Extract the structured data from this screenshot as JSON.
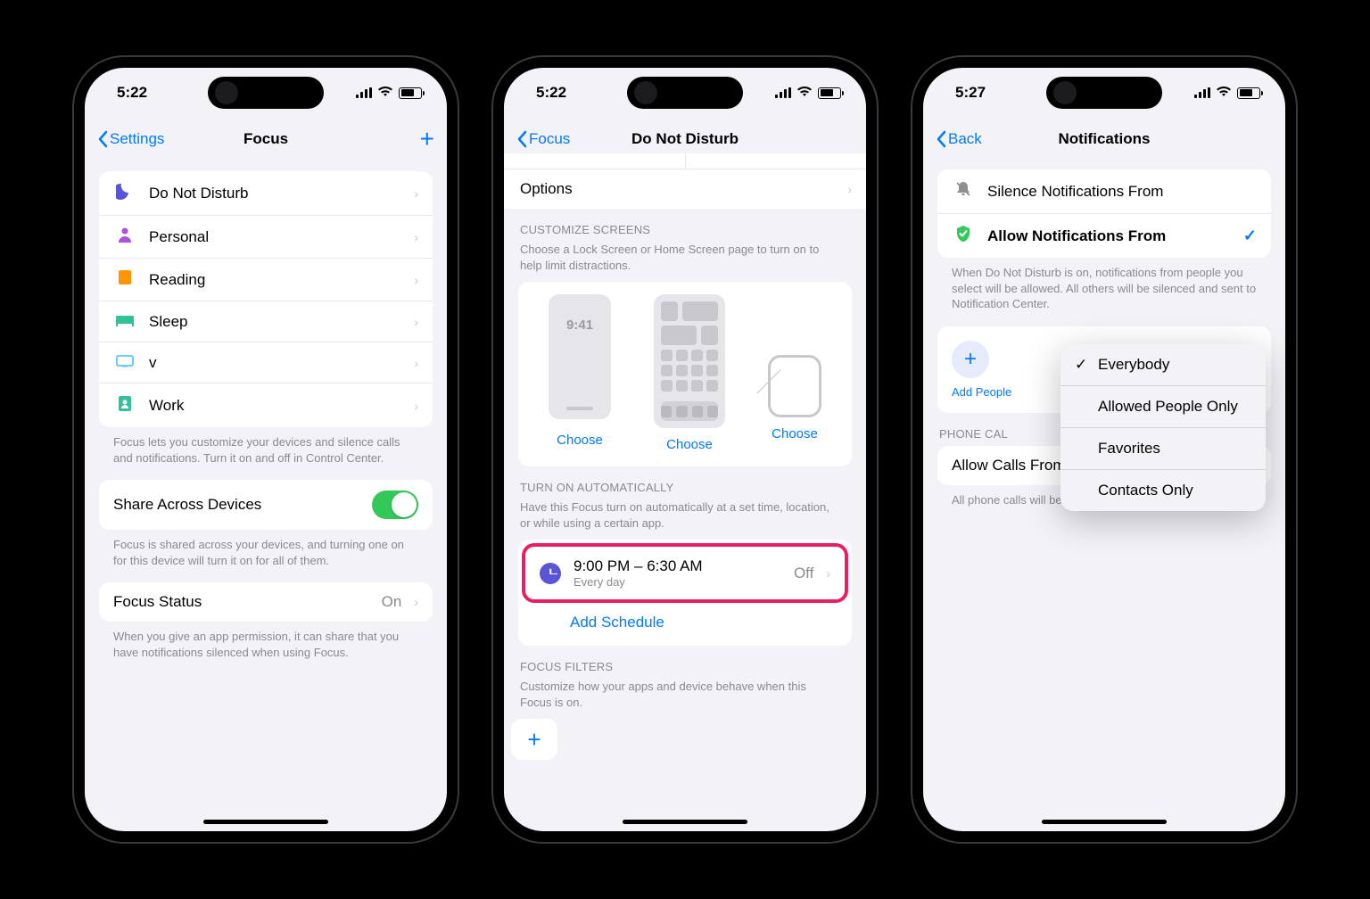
{
  "phone1": {
    "time": "5:22",
    "back": "Settings",
    "title": "Focus",
    "items": [
      {
        "icon": "🌙",
        "cls": "moon",
        "label": "Do Not Disturb"
      },
      {
        "icon": "👤",
        "cls": "person",
        "label": "Personal"
      },
      {
        "icon": "📕",
        "cls": "book",
        "label": "Reading"
      },
      {
        "icon": "🛏",
        "cls": "sleep",
        "label": "Sleep"
      },
      {
        "icon": "🖥",
        "cls": "display",
        "label": "v"
      },
      {
        "icon": "🏷",
        "cls": "work",
        "label": "Work"
      }
    ],
    "note1": "Focus lets you customize your devices and silence calls and notifications. Turn it on and off in Control Center.",
    "share_label": "Share Across Devices",
    "note2": "Focus is shared across your devices, and turning one on for this device will turn it on for all of them.",
    "status_label": "Focus Status",
    "status_value": "On",
    "note3": "When you give an app permission, it can share that you have notifications silenced when using Focus."
  },
  "phone2": {
    "time": "5:22",
    "back": "Focus",
    "title": "Do Not Disturb",
    "options": "Options",
    "customize_header": "CUSTOMIZE SCREENS",
    "customize_sub": "Choose a Lock Screen or Home Screen page to turn on to help limit distractions.",
    "lock_time": "9:41",
    "choose": "Choose",
    "auto_header": "TURN ON AUTOMATICALLY",
    "auto_sub": "Have this Focus turn on automatically at a set time, location, or while using a certain app.",
    "schedule_time": "9:00 PM – 6:30 AM",
    "schedule_sub": "Every day",
    "schedule_state": "Off",
    "add_schedule": "Add Schedule",
    "filters_header": "FOCUS FILTERS",
    "filters_sub": "Customize how your apps and device behave when this Focus is on."
  },
  "phone3": {
    "time": "5:27",
    "back": "Back",
    "title": "Notifications",
    "silence_label": "Silence Notifications From",
    "allow_label": "Allow Notifications From",
    "desc": "When Do Not Disturb is on, notifications from people you select will be allowed. All others will be silenced and sent to Notification Center.",
    "add_people": "Add People",
    "phone_calls_header": "PHONE CALLS",
    "allow_calls_label": "Allow Calls From",
    "allow_calls_value": "Everybody",
    "calls_note": "All phone calls will be allowed.",
    "popup": {
      "items": [
        "Everybody",
        "Allowed People Only",
        "Favorites",
        "Contacts Only"
      ],
      "selected": "Everybody"
    }
  }
}
